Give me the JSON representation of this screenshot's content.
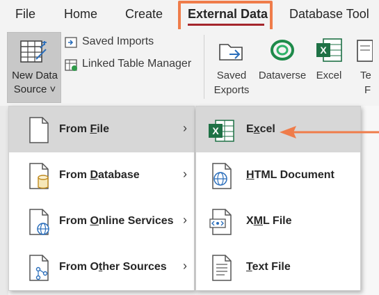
{
  "tabs": [
    {
      "id": "file",
      "label": "File"
    },
    {
      "id": "home",
      "label": "Home"
    },
    {
      "id": "create",
      "label": "Create"
    },
    {
      "id": "external",
      "label": "External Data"
    },
    {
      "id": "dbtools",
      "label": "Database Tool"
    }
  ],
  "ribbon": {
    "new_data_source": {
      "line1": "New Data",
      "line2": "Source ˅"
    },
    "saved_imports": "Saved Imports",
    "linked_table_manager": "Linked Table Manager",
    "saved_exports": {
      "line1": "Saved",
      "line2": "Exports"
    },
    "dataverse": "Dataverse",
    "excel": "Excel",
    "cut_off": {
      "line1": "Te",
      "line2": "F"
    }
  },
  "menu_source": [
    {
      "pre": "From ",
      "key": "F",
      "post": "ile",
      "icon": "file-icon"
    },
    {
      "pre": "From ",
      "key": "D",
      "post": "atabase",
      "icon": "database-icon"
    },
    {
      "pre": "From ",
      "key": "O",
      "post": "nline Services",
      "icon": "online-services-icon"
    },
    {
      "pre": "From O",
      "key": "t",
      "post": "her Sources",
      "icon": "other-sources-icon"
    }
  ],
  "menu_file": [
    {
      "pre": "E",
      "key": "x",
      "post": "cel",
      "icon": "excel-icon"
    },
    {
      "pre": "",
      "key": "H",
      "post": "TML Document",
      "icon": "html-document-icon"
    },
    {
      "pre": "X",
      "key": "M",
      "post": "L File",
      "icon": "xml-file-icon"
    },
    {
      "pre": "",
      "key": "T",
      "post": "ext File",
      "icon": "text-file-icon"
    }
  ],
  "chevron": "›",
  "colors": {
    "highlight": "#ef7c4a",
    "tab_underline": "#a4262c",
    "excel_green": "#1e7145",
    "selected": "#d7d7d7"
  }
}
